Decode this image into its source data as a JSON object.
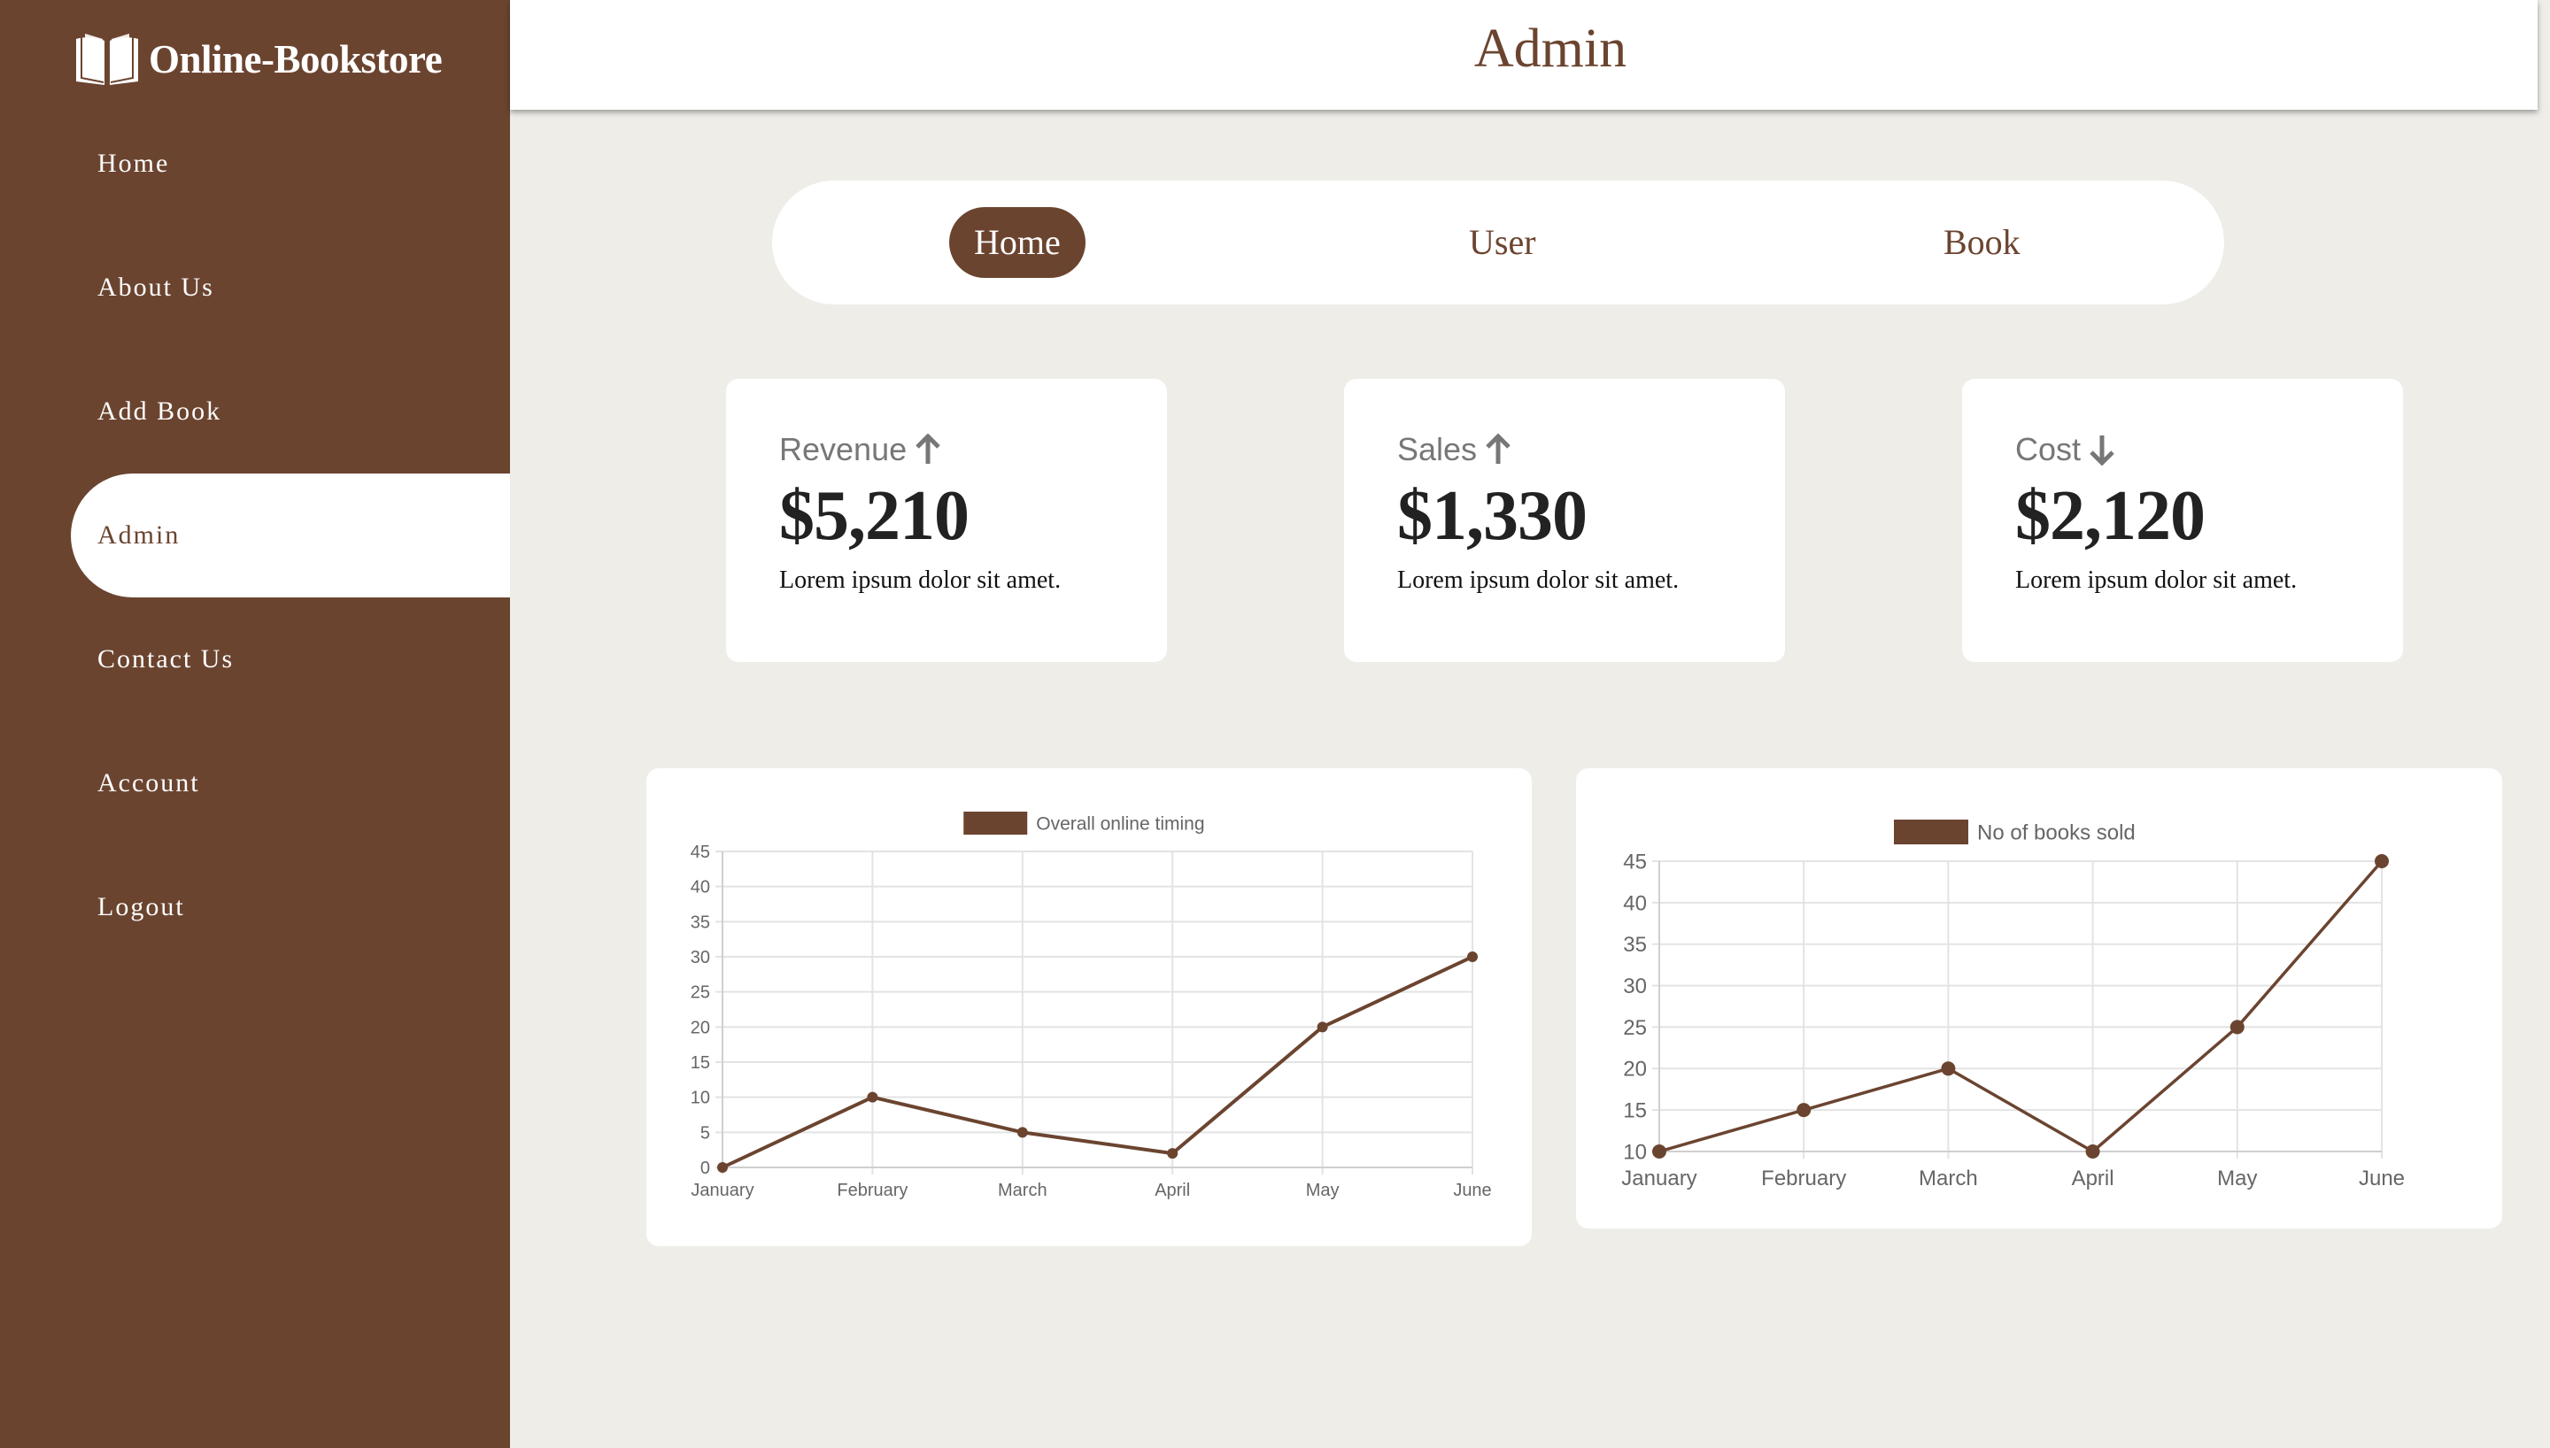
{
  "app": {
    "logo_text": "Online-Bookstore"
  },
  "sidebar": {
    "items": [
      {
        "label": "Home"
      },
      {
        "label": "About Us"
      },
      {
        "label": "Add Book"
      },
      {
        "label": "Admin"
      },
      {
        "label": "Contact Us"
      },
      {
        "label": "Account"
      },
      {
        "label": "Logout"
      }
    ],
    "active": "Admin"
  },
  "header": {
    "title": "Admin"
  },
  "tabs": [
    {
      "label": "Home"
    },
    {
      "label": "User"
    },
    {
      "label": "Book"
    }
  ],
  "cards": [
    {
      "label": "Revenue",
      "trend": "up",
      "value": "$5,210",
      "desc": "Lorem ipsum dolor sit amet."
    },
    {
      "label": "Sales",
      "trend": "up",
      "value": "$1,330",
      "desc": "Lorem ipsum dolor sit amet."
    },
    {
      "label": "Cost",
      "trend": "down",
      "value": "$2,120",
      "desc": "Lorem ipsum dolor sit amet."
    }
  ],
  "colors": {
    "brand": "#6b4430",
    "background": "#eeede8",
    "grid": "#e3e3e3",
    "tick_text": "#666666"
  },
  "chart_data": [
    {
      "type": "line",
      "x": [
        "January",
        "February",
        "March",
        "April",
        "May",
        "June"
      ],
      "series": [
        {
          "name": "Overall online timing",
          "values": [
            0,
            10,
            5,
            2,
            20,
            30
          ]
        }
      ],
      "ylim": [
        0,
        45
      ],
      "yticks": [
        0,
        5,
        10,
        15,
        20,
        25,
        30,
        35,
        40,
        45
      ],
      "grid": true,
      "legend": "top-center"
    },
    {
      "type": "line",
      "x": [
        "January",
        "February",
        "March",
        "April",
        "May",
        "June"
      ],
      "series": [
        {
          "name": "No of books sold",
          "values": [
            10,
            15,
            20,
            10,
            25,
            45
          ]
        }
      ],
      "ylim": [
        10,
        45
      ],
      "yticks": [
        10,
        15,
        20,
        25,
        30,
        35,
        40,
        45
      ],
      "grid": true,
      "legend": "top-center"
    }
  ]
}
